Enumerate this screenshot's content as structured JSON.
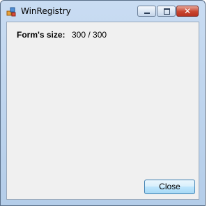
{
  "window": {
    "title": "WinRegistry",
    "buttons": {
      "minimize_icon": "minimize-icon",
      "maximize_icon": "maximize-icon",
      "close_glyph": "✕"
    }
  },
  "main": {
    "size_label": "Form's size:",
    "size_value": "300 / 300",
    "close_button_label": "Close"
  },
  "colors": {
    "close_button_border": "#3c7fb1",
    "caption_close": "#c8452f",
    "client_background": "#f0f0f0"
  }
}
